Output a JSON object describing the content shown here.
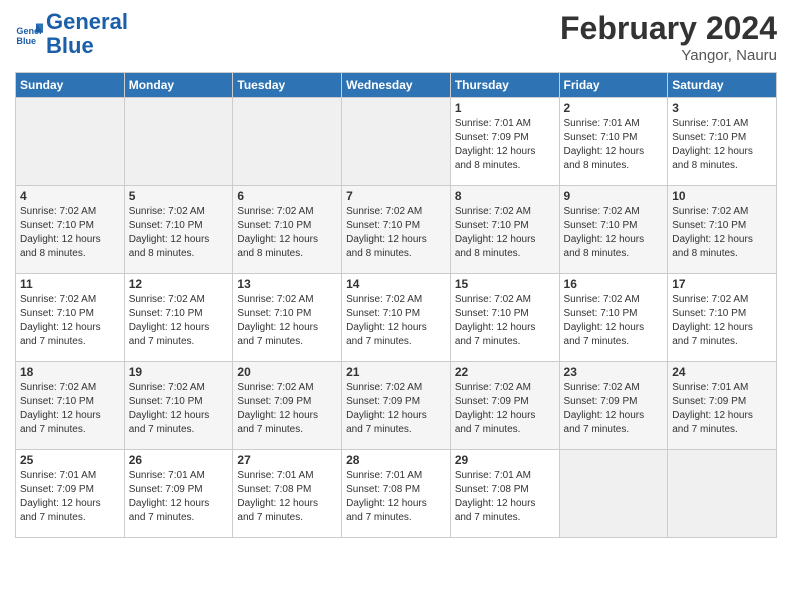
{
  "header": {
    "logo_line1": "General",
    "logo_line2": "Blue",
    "title": "February 2024",
    "subtitle": "Yangor, Nauru"
  },
  "weekdays": [
    "Sunday",
    "Monday",
    "Tuesday",
    "Wednesday",
    "Thursday",
    "Friday",
    "Saturday"
  ],
  "weeks": [
    [
      {
        "day": "",
        "info": ""
      },
      {
        "day": "",
        "info": ""
      },
      {
        "day": "",
        "info": ""
      },
      {
        "day": "",
        "info": ""
      },
      {
        "day": "1",
        "info": "Sunrise: 7:01 AM\nSunset: 7:09 PM\nDaylight: 12 hours\nand 8 minutes."
      },
      {
        "day": "2",
        "info": "Sunrise: 7:01 AM\nSunset: 7:10 PM\nDaylight: 12 hours\nand 8 minutes."
      },
      {
        "day": "3",
        "info": "Sunrise: 7:01 AM\nSunset: 7:10 PM\nDaylight: 12 hours\nand 8 minutes."
      }
    ],
    [
      {
        "day": "4",
        "info": "Sunrise: 7:02 AM\nSunset: 7:10 PM\nDaylight: 12 hours\nand 8 minutes."
      },
      {
        "day": "5",
        "info": "Sunrise: 7:02 AM\nSunset: 7:10 PM\nDaylight: 12 hours\nand 8 minutes."
      },
      {
        "day": "6",
        "info": "Sunrise: 7:02 AM\nSunset: 7:10 PM\nDaylight: 12 hours\nand 8 minutes."
      },
      {
        "day": "7",
        "info": "Sunrise: 7:02 AM\nSunset: 7:10 PM\nDaylight: 12 hours\nand 8 minutes."
      },
      {
        "day": "8",
        "info": "Sunrise: 7:02 AM\nSunset: 7:10 PM\nDaylight: 12 hours\nand 8 minutes."
      },
      {
        "day": "9",
        "info": "Sunrise: 7:02 AM\nSunset: 7:10 PM\nDaylight: 12 hours\nand 8 minutes."
      },
      {
        "day": "10",
        "info": "Sunrise: 7:02 AM\nSunset: 7:10 PM\nDaylight: 12 hours\nand 8 minutes."
      }
    ],
    [
      {
        "day": "11",
        "info": "Sunrise: 7:02 AM\nSunset: 7:10 PM\nDaylight: 12 hours\nand 7 minutes."
      },
      {
        "day": "12",
        "info": "Sunrise: 7:02 AM\nSunset: 7:10 PM\nDaylight: 12 hours\nand 7 minutes."
      },
      {
        "day": "13",
        "info": "Sunrise: 7:02 AM\nSunset: 7:10 PM\nDaylight: 12 hours\nand 7 minutes."
      },
      {
        "day": "14",
        "info": "Sunrise: 7:02 AM\nSunset: 7:10 PM\nDaylight: 12 hours\nand 7 minutes."
      },
      {
        "day": "15",
        "info": "Sunrise: 7:02 AM\nSunset: 7:10 PM\nDaylight: 12 hours\nand 7 minutes."
      },
      {
        "day": "16",
        "info": "Sunrise: 7:02 AM\nSunset: 7:10 PM\nDaylight: 12 hours\nand 7 minutes."
      },
      {
        "day": "17",
        "info": "Sunrise: 7:02 AM\nSunset: 7:10 PM\nDaylight: 12 hours\nand 7 minutes."
      }
    ],
    [
      {
        "day": "18",
        "info": "Sunrise: 7:02 AM\nSunset: 7:10 PM\nDaylight: 12 hours\nand 7 minutes."
      },
      {
        "day": "19",
        "info": "Sunrise: 7:02 AM\nSunset: 7:10 PM\nDaylight: 12 hours\nand 7 minutes."
      },
      {
        "day": "20",
        "info": "Sunrise: 7:02 AM\nSunset: 7:09 PM\nDaylight: 12 hours\nand 7 minutes."
      },
      {
        "day": "21",
        "info": "Sunrise: 7:02 AM\nSunset: 7:09 PM\nDaylight: 12 hours\nand 7 minutes."
      },
      {
        "day": "22",
        "info": "Sunrise: 7:02 AM\nSunset: 7:09 PM\nDaylight: 12 hours\nand 7 minutes."
      },
      {
        "day": "23",
        "info": "Sunrise: 7:02 AM\nSunset: 7:09 PM\nDaylight: 12 hours\nand 7 minutes."
      },
      {
        "day": "24",
        "info": "Sunrise: 7:01 AM\nSunset: 7:09 PM\nDaylight: 12 hours\nand 7 minutes."
      }
    ],
    [
      {
        "day": "25",
        "info": "Sunrise: 7:01 AM\nSunset: 7:09 PM\nDaylight: 12 hours\nand 7 minutes."
      },
      {
        "day": "26",
        "info": "Sunrise: 7:01 AM\nSunset: 7:09 PM\nDaylight: 12 hours\nand 7 minutes."
      },
      {
        "day": "27",
        "info": "Sunrise: 7:01 AM\nSunset: 7:08 PM\nDaylight: 12 hours\nand 7 minutes."
      },
      {
        "day": "28",
        "info": "Sunrise: 7:01 AM\nSunset: 7:08 PM\nDaylight: 12 hours\nand 7 minutes."
      },
      {
        "day": "29",
        "info": "Sunrise: 7:01 AM\nSunset: 7:08 PM\nDaylight: 12 hours\nand 7 minutes."
      },
      {
        "day": "",
        "info": ""
      },
      {
        "day": "",
        "info": ""
      }
    ]
  ]
}
